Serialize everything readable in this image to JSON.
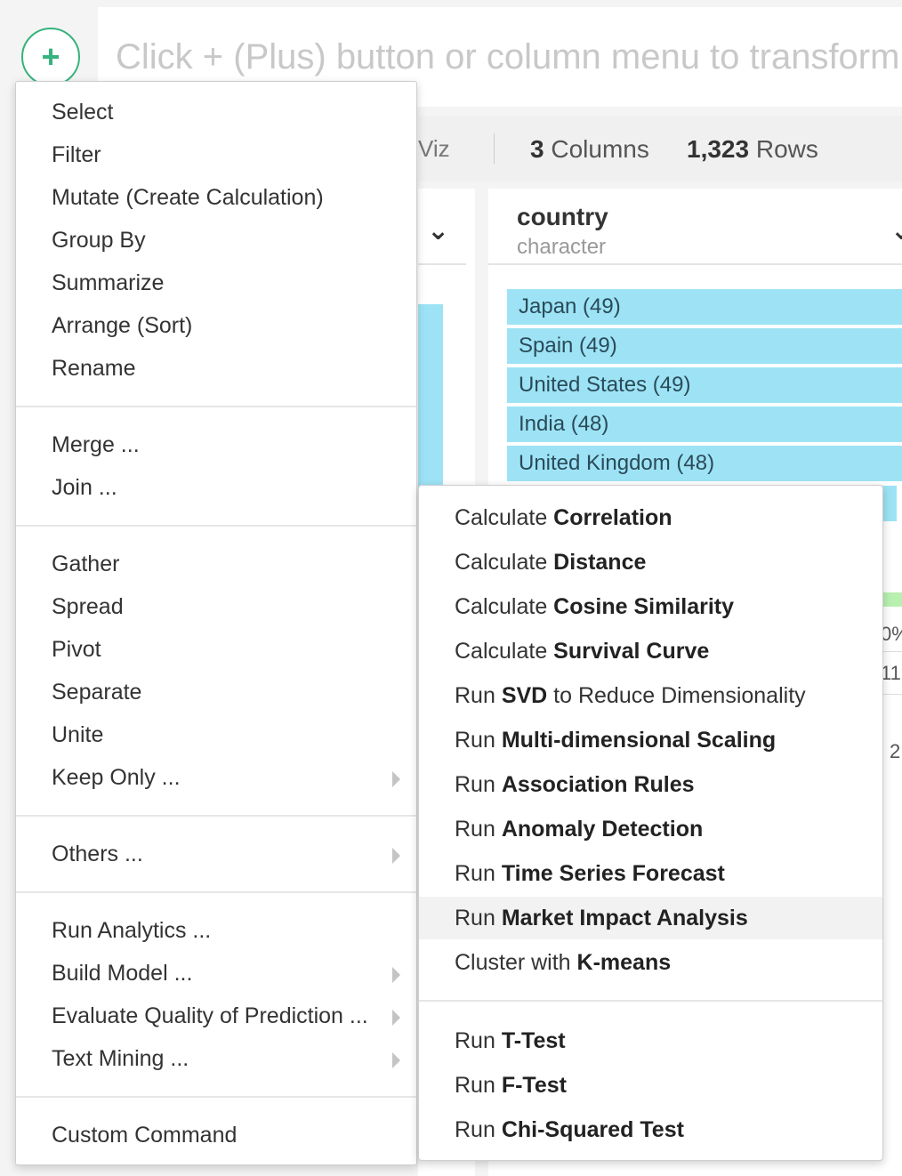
{
  "command_bar": {
    "plus_icon": "plus-icon",
    "placeholder": "Click + (Plus) button or column menu to transform"
  },
  "summary": {
    "viz_label": "Viz",
    "columns_count": "3",
    "columns_label": "Columns",
    "rows_count": "1,323",
    "rows_label": "Rows"
  },
  "column": {
    "name": "country",
    "type": "character",
    "bars": [
      {
        "label": "Japan (49)"
      },
      {
        "label": "Spain (49)"
      },
      {
        "label": "United States (49)"
      },
      {
        "label": "India (48)"
      },
      {
        "label": "United Kingdom (48)"
      }
    ],
    "peek_values": [
      "0%",
      "11",
      "2"
    ]
  },
  "menu": {
    "group1": [
      "Select",
      "Filter",
      "Mutate (Create Calculation)",
      "Group By",
      "Summarize",
      "Arrange (Sort)",
      "Rename"
    ],
    "group2": [
      "Merge ...",
      "Join ..."
    ],
    "group3": [
      "Gather",
      "Spread",
      "Pivot",
      "Separate",
      "Unite",
      "Keep Only ..."
    ],
    "group4": [
      "Others ..."
    ],
    "group5": [
      "Run Analytics ...",
      "Build Model ...",
      "Evaluate Quality of Prediction ...",
      "Text Mining ..."
    ],
    "group6": [
      "Custom Command"
    ]
  },
  "submenu": {
    "items": [
      {
        "prefix": "Calculate ",
        "bold": "Correlation",
        "suffix": ""
      },
      {
        "prefix": "Calculate ",
        "bold": "Distance",
        "suffix": ""
      },
      {
        "prefix": "Calculate ",
        "bold": "Cosine Similarity",
        "suffix": ""
      },
      {
        "prefix": "Calculate ",
        "bold": "Survival Curve",
        "suffix": ""
      },
      {
        "prefix": "Run ",
        "bold": "SVD",
        "suffix": " to Reduce Dimensionality"
      },
      {
        "prefix": "Run ",
        "bold": "Multi-dimensional Scaling",
        "suffix": ""
      },
      {
        "prefix": "Run ",
        "bold": "Association Rules",
        "suffix": ""
      },
      {
        "prefix": "Run ",
        "bold": "Anomaly Detection",
        "suffix": ""
      },
      {
        "prefix": "Run ",
        "bold": "Time Series Forecast",
        "suffix": ""
      },
      {
        "prefix": "Run ",
        "bold": "Market Impact Analysis",
        "suffix": ""
      },
      {
        "prefix": "Cluster with ",
        "bold": "K-means",
        "suffix": ""
      }
    ],
    "tests": [
      {
        "prefix": "Run ",
        "bold": "T-Test",
        "suffix": ""
      },
      {
        "prefix": "Run ",
        "bold": "F-Test",
        "suffix": ""
      },
      {
        "prefix": "Run ",
        "bold": "Chi-Squared Test",
        "suffix": ""
      }
    ]
  },
  "colors": {
    "accent": "#36b37e",
    "bar": "#9de3f5",
    "hover": "#f2f2f2"
  }
}
